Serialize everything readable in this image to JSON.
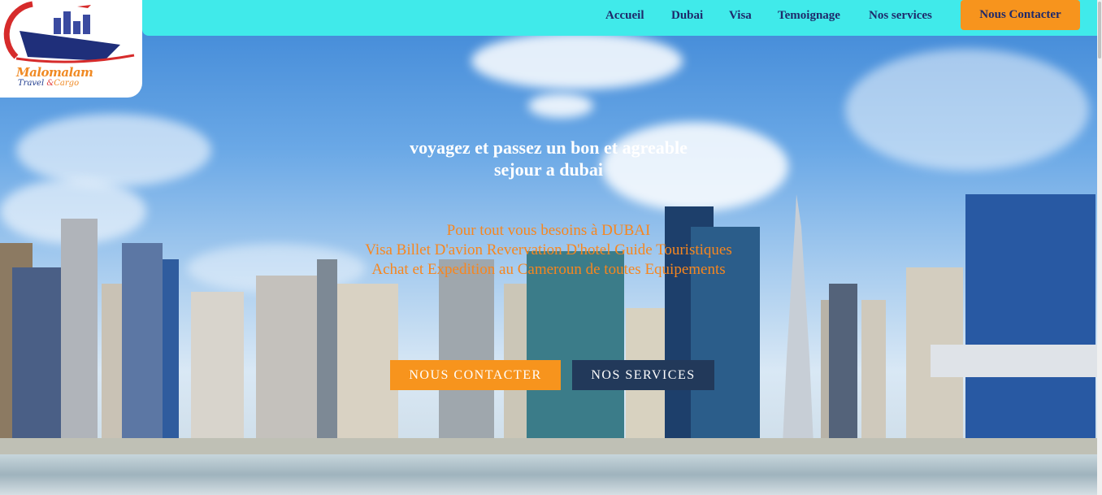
{
  "brand": {
    "logo_name": "Malomalam",
    "logo_tagline_1": "Travel",
    "logo_tagline_amp": "&",
    "logo_tagline_2": "Cargo"
  },
  "nav": {
    "items": [
      {
        "label": "Accueil"
      },
      {
        "label": "Dubai"
      },
      {
        "label": "Visa"
      },
      {
        "label": "Temoignage"
      },
      {
        "label": "Nos services"
      }
    ],
    "cta_label": "Nous Contacter"
  },
  "hero": {
    "headline_line1": "voyagez et passez un bon et agreable",
    "headline_line2": "sejour a dubai",
    "sub_line1": "Pour tout vous besoins à DUBAI",
    "sub_line2": "Visa Billet D'avion Revervation D'hotel Guide Touristiques",
    "sub_line3": "Achat et Expedition au Cameroun de toutes Equipements",
    "btn_contact": "NOUS CONTACTER",
    "btn_services": "NOS SERVICES"
  },
  "colors": {
    "navbar": "#40eaea",
    "accent_orange": "#f7941d",
    "nav_text": "#1f2a6b",
    "dark_button": "#22395a"
  }
}
